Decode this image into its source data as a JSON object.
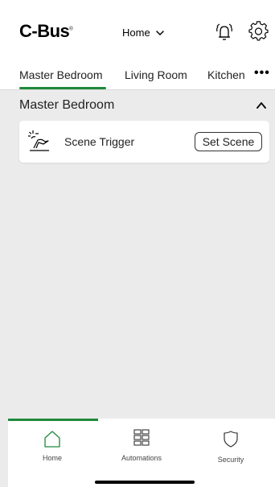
{
  "header": {
    "logo_text": "C-Bus",
    "logo_mark": "®",
    "home_selector": "Home",
    "alarm_icon": "alarm-bell-icon",
    "settings_icon": "gear-icon"
  },
  "tabs": {
    "items": [
      {
        "label": "Master Bedroom",
        "active": true
      },
      {
        "label": "Living Room",
        "active": false
      },
      {
        "label": "Kitchen",
        "active": false
      }
    ],
    "more_label": "•••"
  },
  "section": {
    "title": "Master Bedroom",
    "expanded": true
  },
  "scene_card": {
    "icon": "scene-trigger-icon",
    "label": "Scene Trigger",
    "button_label": "Set Scene"
  },
  "bottom_nav": {
    "items": [
      {
        "label": "Home",
        "icon": "home-icon",
        "active": true
      },
      {
        "label": "Automations",
        "icon": "grid-icon",
        "active": false
      },
      {
        "label": "Security",
        "icon": "shield-icon",
        "active": false
      }
    ]
  },
  "colors": {
    "accent": "#1f8a3a",
    "background": "#ebebeb",
    "surface": "#ffffff"
  }
}
